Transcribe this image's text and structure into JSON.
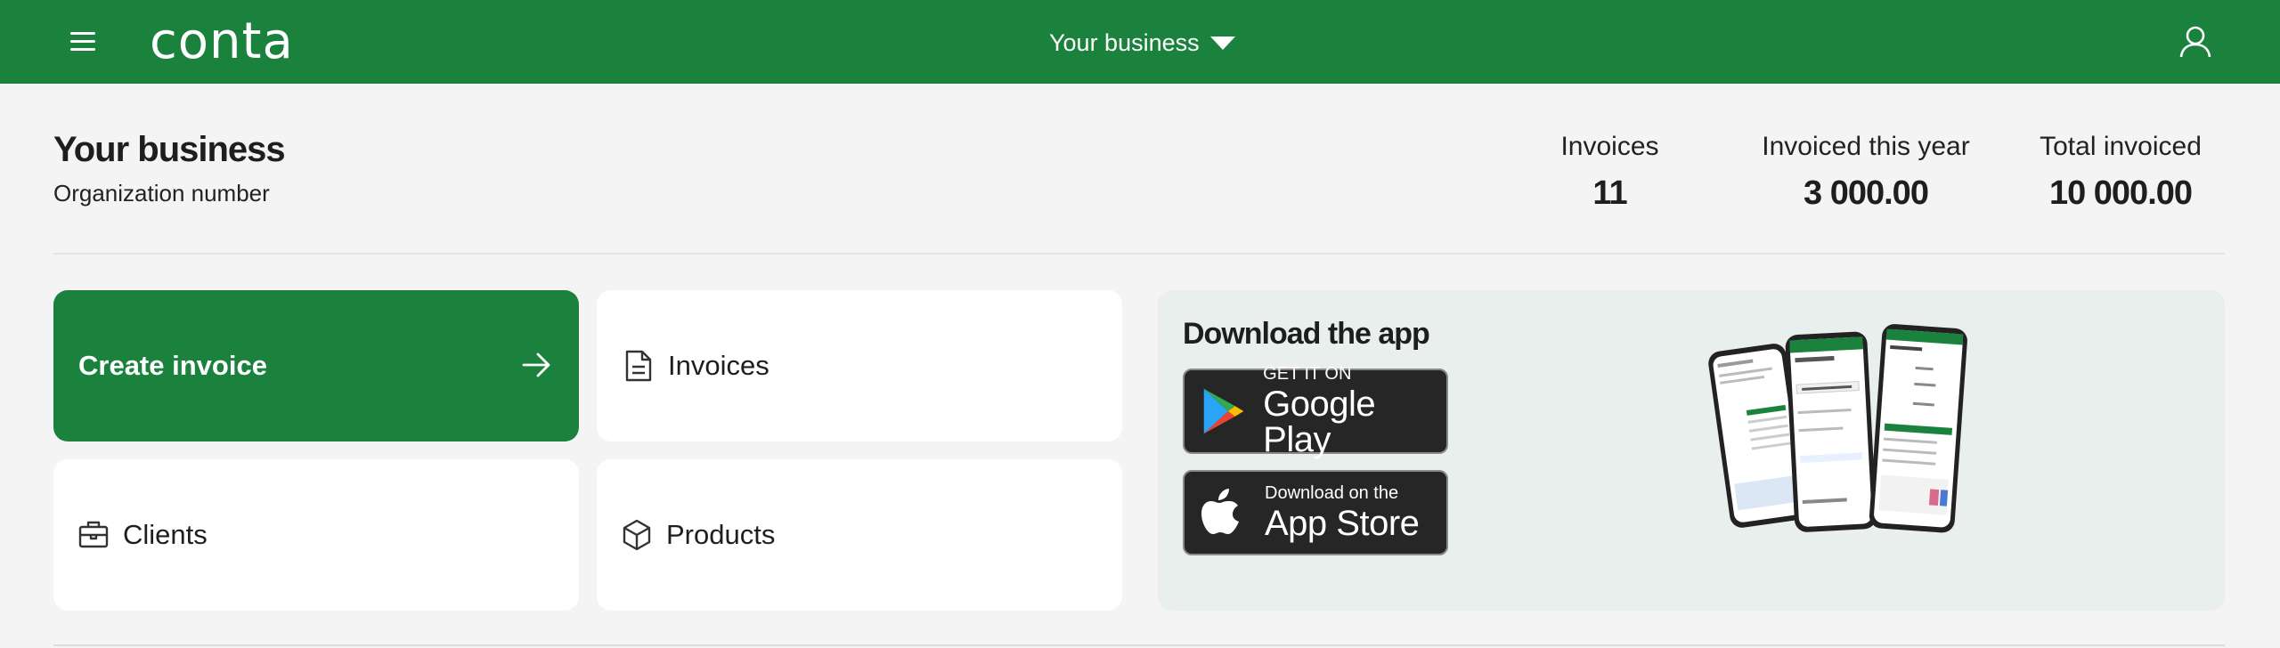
{
  "header": {
    "logo_text": "conta",
    "business_switcher_label": "Your business",
    "brand_color": "#1b823e"
  },
  "business": {
    "name": "Your business",
    "subtitle": "Organization number"
  },
  "stats": [
    {
      "label": "Invoices",
      "value": "11"
    },
    {
      "label": "Invoiced this year",
      "value": "3 000.00"
    },
    {
      "label": "Total invoiced",
      "value": "10 000.00"
    }
  ],
  "actions": {
    "create_invoice": "Create invoice",
    "invoices": "Invoices",
    "clients": "Clients",
    "products": "Products"
  },
  "download": {
    "title": "Download the app",
    "google_play": {
      "small": "GET IT ON",
      "big": "Google Play"
    },
    "app_store": {
      "small": "Download on the",
      "big": "App Store"
    }
  },
  "icons": [
    "menu-icon",
    "user-icon",
    "arrow-right-icon",
    "document-icon",
    "briefcase-icon",
    "box-icon",
    "google-play-icon",
    "apple-icon"
  ]
}
